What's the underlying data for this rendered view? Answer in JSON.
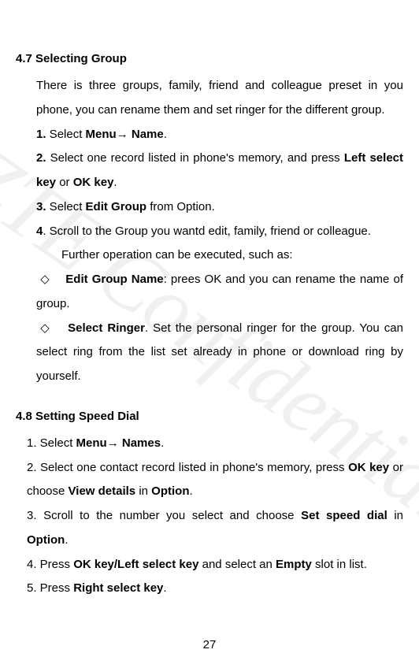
{
  "watermark": "ZTE Confidential",
  "page_number": "27",
  "sec47": {
    "heading": "4.7 Selecting Group",
    "intro": "There is three groups, family, friend and colleague preset in you phone, you can rename them and set ringer for the different group.",
    "steps": {
      "s1": {
        "num": "1.",
        "a": " Select ",
        "b": "Menu→ Name",
        "c": "."
      },
      "s2": {
        "num": "2.",
        "a": " Select one record listed in phone's memory, and press ",
        "b": "Left select key",
        "c": " or ",
        "d": "OK key",
        "e": "."
      },
      "s3": {
        "num": "3.",
        "a": " Select ",
        "b": "Edit Group",
        "c": " from Option."
      },
      "s4": {
        "num": "4",
        "a": ". Scroll to the Group you wantd edit, family, friend or colleague."
      },
      "s4b": "Further operation can be executed, such as:"
    },
    "bullets": {
      "diamond": "◇",
      "b1": {
        "head": "Edit Group Name",
        "tail": ": prees OK and you can rename the name of group."
      },
      "b2": {
        "head": "Select Ringer",
        "tail": ". Set the personal ringer for the group. You can select ring from the list set already in phone or download ring by yourself."
      }
    }
  },
  "sec48": {
    "heading": "4.8 Setting Speed Dial",
    "steps": {
      "s1": {
        "a": "1. Select ",
        "b": "Menu→ Names",
        "c": "."
      },
      "s2": {
        "a": "2. Select one contact record listed in phone's memory, press ",
        "b": "OK key",
        "c": " or choose ",
        "d": "View details",
        "e": " in ",
        "f": "Option",
        "g": "."
      },
      "s3": {
        "a": "3. Scroll to the number you select and choose ",
        "b": "Set speed dial",
        "c": " in ",
        "d": "Option",
        "e": "."
      },
      "s4": {
        "a": "4. Press ",
        "b": "OK key/Left select key",
        "c": " and select an ",
        "d": "Empty",
        "e": " slot in list."
      },
      "s5": {
        "a": "5. Press ",
        "b": "Right select key",
        "c": "."
      }
    }
  }
}
